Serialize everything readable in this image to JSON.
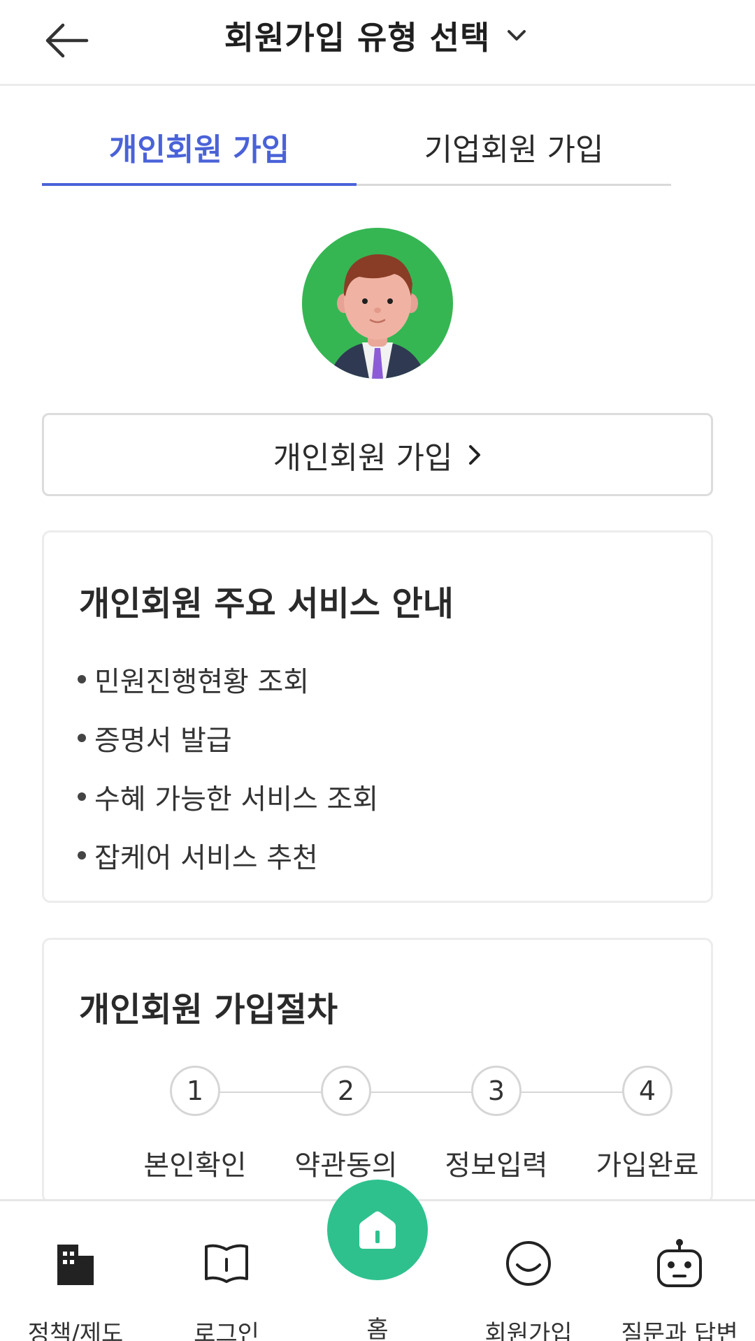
{
  "header": {
    "title": "회원가입 유형 선택"
  },
  "tabs": [
    {
      "label": "개인회원 가입",
      "active": true
    },
    {
      "label": "기업회원 가입",
      "active": false
    }
  ],
  "join_button": {
    "label": "개인회원 가입"
  },
  "services_card": {
    "title": "개인회원 주요 서비스 안내",
    "items": [
      "민원진행현황 조회",
      "증명서 발급",
      "수혜 가능한 서비스 조회",
      "잡케어 서비스 추천"
    ]
  },
  "process_card": {
    "title": "개인회원 가입절차",
    "steps": [
      {
        "number": "1",
        "label": "본인확인"
      },
      {
        "number": "2",
        "label": "약관동의"
      },
      {
        "number": "3",
        "label": "정보입력"
      },
      {
        "number": "4",
        "label": "가입완료"
      }
    ]
  },
  "bottom_nav": [
    {
      "label": "정책/제도",
      "icon": "building-icon"
    },
    {
      "label": "로그인",
      "icon": "book-icon"
    },
    {
      "label": "홈",
      "icon": "home-icon"
    },
    {
      "label": "회원가입",
      "icon": "smile-icon"
    },
    {
      "label": "질문과 답변",
      "icon": "robot-icon"
    }
  ],
  "colors": {
    "accent": "#4a62d8",
    "home": "#2ec18e",
    "avatar_bg": "#35b653"
  }
}
